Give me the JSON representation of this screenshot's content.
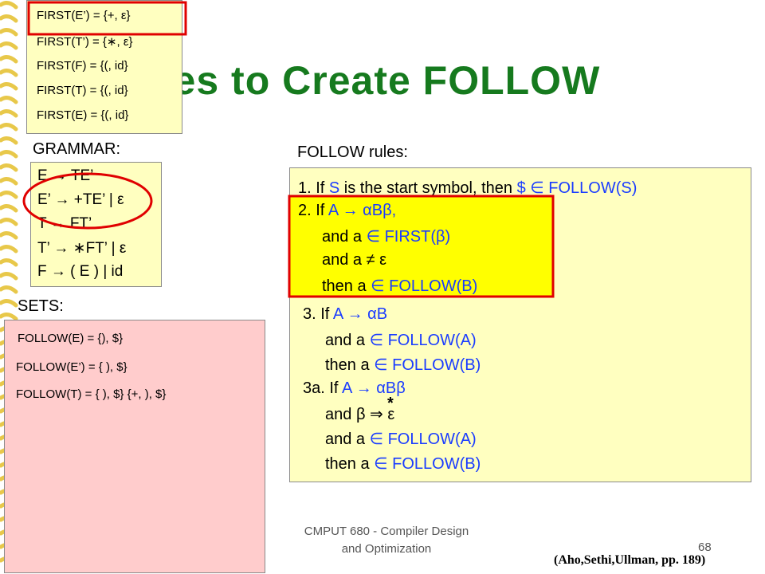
{
  "slide": {
    "title": "Rules to Create FOLLOW",
    "title_color": "#167a1e",
    "footer_course": "CMPUT 680 - Compiler Design",
    "footer_course2": "and Optimization",
    "page_number": "68",
    "citation": "(Aho,Sethi,Ullman, pp. 189)"
  },
  "first_sets": [
    "FIRST(E’) = {+, ε}",
    "FIRST(T’) = {∗, ε}",
    "FIRST(F) = {(, id}",
    "FIRST(T) = {(, id}",
    "FIRST(E)  = {(, id}"
  ],
  "grammar": {
    "heading": "GRAMMAR:",
    "rules": [
      "E  → TE’",
      "E’ → +TE’ | ε",
      "T  → FT’",
      "T’ → ∗FT’ | ε",
      "F  → ( E ) | id"
    ]
  },
  "sets": {
    "heading": "SETS:",
    "follow": [
      "FOLLOW(E) = {), $}",
      "FOLLOW(E’) = { ), $}",
      "FOLLOW(T) = { ), $} {+, ), $}"
    ]
  },
  "rules": {
    "heading": "FOLLOW rules:",
    "r1a": "1. If ",
    "r1b": "S",
    "r1c": " is the start symbol, then ",
    "r1d": "$ ∈ FOLLOW(S)",
    "r2a": "2. If ",
    "r2b": "A → αBβ,",
    "r2c": "and a ",
    "r2d": "∈ FIRST(β)",
    "r2e": "and a ≠ ε",
    "r2f": "then a ",
    "r2g": "∈ FOLLOW(B)",
    "r3a": "3. If ",
    "r3b": "A → αB",
    "r3c": "and a ",
    "r3d": "∈ FOLLOW(A)",
    "r3e": "then a ",
    "r3f": "∈ FOLLOW(B)",
    "r4a": "3a. If ",
    "r4b": "A → αBβ",
    "r4c": "and ",
    "r4d": "β ⇒ ε",
    "r4star": "*",
    "r4e": "and a ",
    "r4f": "∈ FOLLOW(A)",
    "r4g": "then a ",
    "r4h": "∈ FOLLOW(B)"
  },
  "colors": {
    "note_yellow": "#ffffc0",
    "rule_highlight": "#ffff00",
    "sets_pink": "#ffcccc",
    "annotation_red": "#e00000",
    "binder_gold": "#e8c84a"
  }
}
